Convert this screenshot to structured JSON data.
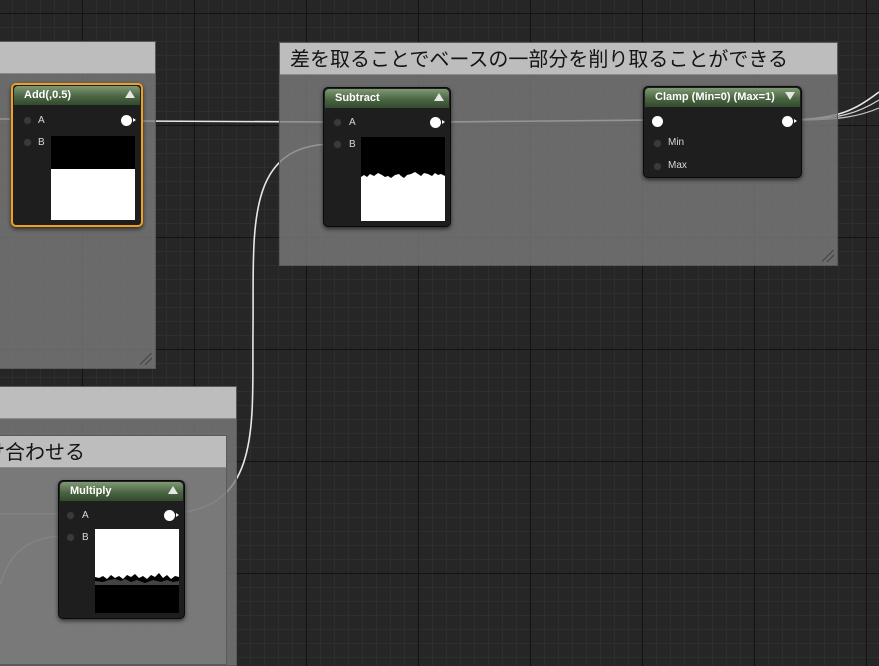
{
  "comments": {
    "left_top": {
      "title": ""
    },
    "subtract_group": {
      "title": "差を取ることでベースの一部分を削り取ることができる"
    },
    "left_mid": {
      "title": ""
    },
    "multiply_group": {
      "title": "掛け合わせる"
    }
  },
  "nodes": {
    "add": {
      "title": "Add(,0.5)",
      "pin_a": "A",
      "pin_b": "B"
    },
    "subtract": {
      "title": "Subtract",
      "pin_a": "A",
      "pin_b": "B"
    },
    "clamp": {
      "title": "Clamp (Min=0) (Max=1)",
      "pin_min": "Min",
      "pin_max": "Max"
    },
    "multiply": {
      "title": "Multiply",
      "pin_a": "A",
      "pin_b": "B"
    }
  },
  "colors": {
    "canvas": "#262626",
    "node_header": "#4b6543",
    "selection": "#f0a020",
    "wire": "#ffffff"
  }
}
